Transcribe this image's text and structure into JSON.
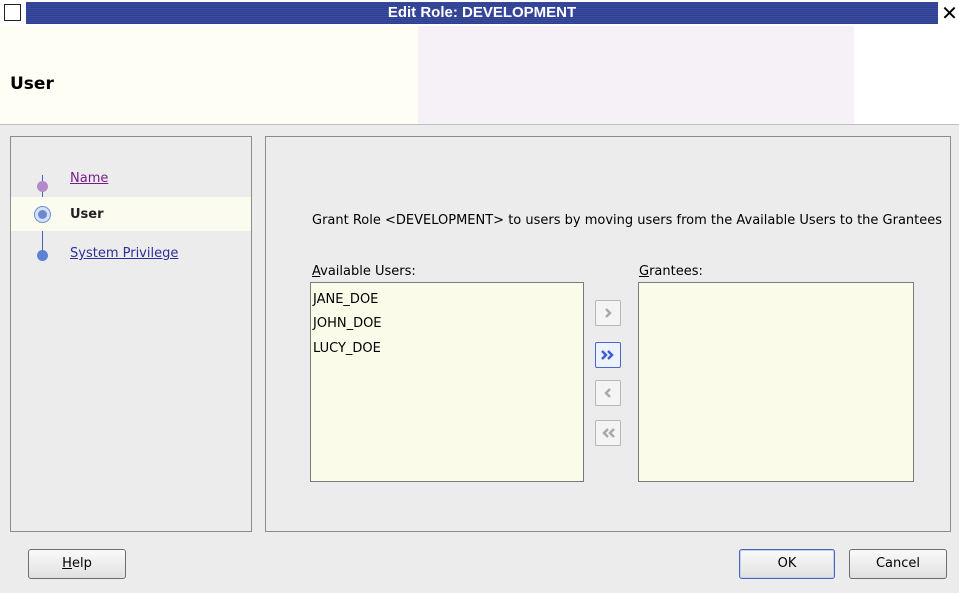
{
  "window": {
    "title": "Edit Role: DEVELOPMENT",
    "close_glyph": "✕"
  },
  "header": {
    "title": "User"
  },
  "nav": {
    "items": [
      {
        "label": "Name",
        "state": "visited"
      },
      {
        "label": "User",
        "state": "current"
      },
      {
        "label": "System Privilege",
        "state": "link"
      }
    ]
  },
  "main": {
    "description": "Grant Role <DEVELOPMENT> to users by moving users from the Available Users to the Grantees",
    "available_label_mnemonic": "A",
    "available_label_rest": "vailable Users:",
    "grantees_label_mnemonic": "G",
    "grantees_label_rest": "rantees:",
    "available_users": [
      "JANE_DOE",
      "JOHN_DOE",
      "LUCY_DOE"
    ],
    "grantees": []
  },
  "shuttle": {
    "move": {
      "icon": "move-right-icon",
      "enabled": false
    },
    "move_all": {
      "icon": "move-all-right-icon",
      "enabled": true
    },
    "remove": {
      "icon": "move-left-icon",
      "enabled": false
    },
    "remove_all": {
      "icon": "move-all-left-icon",
      "enabled": false
    }
  },
  "buttons": {
    "help_mnemonic": "H",
    "help_rest": "elp",
    "ok": "OK",
    "cancel": "Cancel"
  },
  "colors": {
    "title_bar": "#2e3f92",
    "link": "#2c2f9a",
    "visited_link": "#7a1d8c",
    "list_background": "#fbfbe9",
    "active_nav_background": "#fbfbef"
  }
}
